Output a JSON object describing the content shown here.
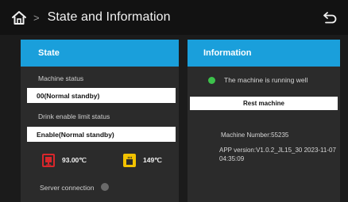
{
  "header": {
    "title": "State and Information",
    "home_icon": "home-icon",
    "back_icon": "back-arrow-icon"
  },
  "state": {
    "title": "State",
    "machine_status_label": "Machine status",
    "machine_status_value": "00(Normal standby)",
    "drink_limit_label": "Drink enable limit status",
    "drink_limit_value": "Enable(Normal standby)",
    "temp1": {
      "value": "93.00℃",
      "icon": "boiler-temperature-icon",
      "color": "#d9262b"
    },
    "temp2": {
      "value": "149℃",
      "icon": "steam-temperature-icon",
      "color": "#f2c200"
    },
    "server_label": "Server connection",
    "server_status_color": "#6a6a6a"
  },
  "info": {
    "title": "Information",
    "running_text": "The machine is running well",
    "running_color": "#3cc24b",
    "restart_label": "Rest machine",
    "machine_number": "Machine Number:55235",
    "app_version": "APP version:V1.0.2_JL15_30 2023-11-07 04:35:09"
  },
  "colors": {
    "accent": "#1a9fdb",
    "panel": "#2b2b2b",
    "background": "#1b1b1b"
  }
}
